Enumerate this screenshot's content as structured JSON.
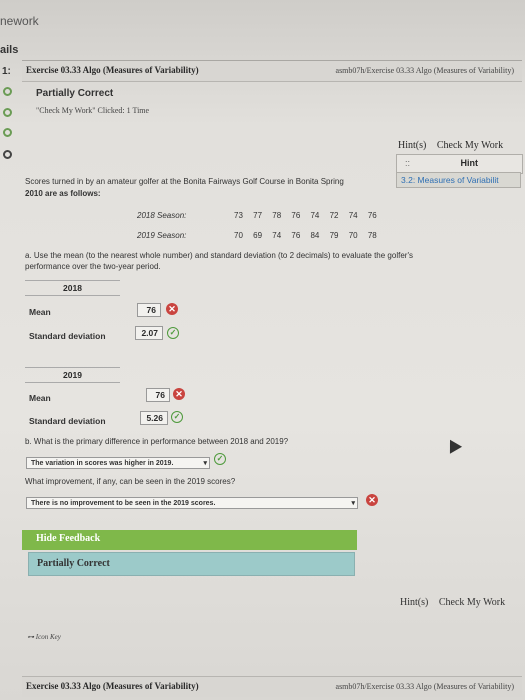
{
  "top": {
    "title": "nework",
    "rail_label": "ails",
    "rail_num": "1:"
  },
  "header": {
    "title": "Exercise 03.33 Algo (Measures of Variability)",
    "right": "asmb07h/Exercise 03.33 Algo (Measures of Variability)"
  },
  "status": {
    "title": "Partially Correct",
    "sub": "\"Check My Work\" Clicked: 1 Time"
  },
  "links": {
    "hints": "Hint(s)",
    "check": "Check My Work"
  },
  "hint_panel": {
    "handle": "::",
    "title": "Hint",
    "sub": "3.2: Measures of Variabilit"
  },
  "question": {
    "intro1": "Scores turned in by an amateur golfer at the Bonita Fairways Golf Course in Bonita Spring",
    "intro2": "2010 are as follows:",
    "season_2018_label": "2018 Season:",
    "season_2018_values": "73 77 78 76 74 72 74 76",
    "season_2019_label": "2019 Season:",
    "season_2019_values": "70 69 74 76 84 79 70 78",
    "part_a1": "a. Use the mean (to the nearest whole number) and standard deviation (to 2 decimals) to evaluate the golfer's",
    "part_a2": "performance over the two-year period.",
    "part_b": "b. What is the primary difference in performance between 2018 and 2019?",
    "improve": "What improvement, if any, can be seen in the 2019 scores?"
  },
  "y2018": {
    "header": "2018",
    "mean_label": "Mean",
    "mean_value": "76",
    "sd_label": "Standard deviation",
    "sd_value": "2.07"
  },
  "y2019": {
    "header": "2019",
    "mean_label": "Mean",
    "mean_value": "76",
    "sd_label": "Standard deviation",
    "sd_value": "5.26"
  },
  "answers": {
    "b_selected": "The variation in scores was higher in 2019.",
    "improve_selected": "There is no improvement to be seen in the 2019 scores."
  },
  "feedback": {
    "title": "Hide Feedback",
    "body": "Partially Correct"
  },
  "footer": {
    "icon_key": "Icon Key",
    "title": "Exercise 03.33 Algo (Measures of Variability)",
    "right": "asmb07h/Exercise 03.33 Algo (Measures of Variability)"
  },
  "colors": {
    "correct": "#4e9a3c",
    "incorrect": "#c9443f",
    "feedback_bar": "#7fb84a",
    "feedback_body": "#9ccac9",
    "hint_link": "#2e6fb4"
  },
  "icons": [
    "x-icon",
    "check-icon",
    "chevron-down-icon",
    "key-icon",
    "drag-handle-icon",
    "cursor-icon"
  ]
}
